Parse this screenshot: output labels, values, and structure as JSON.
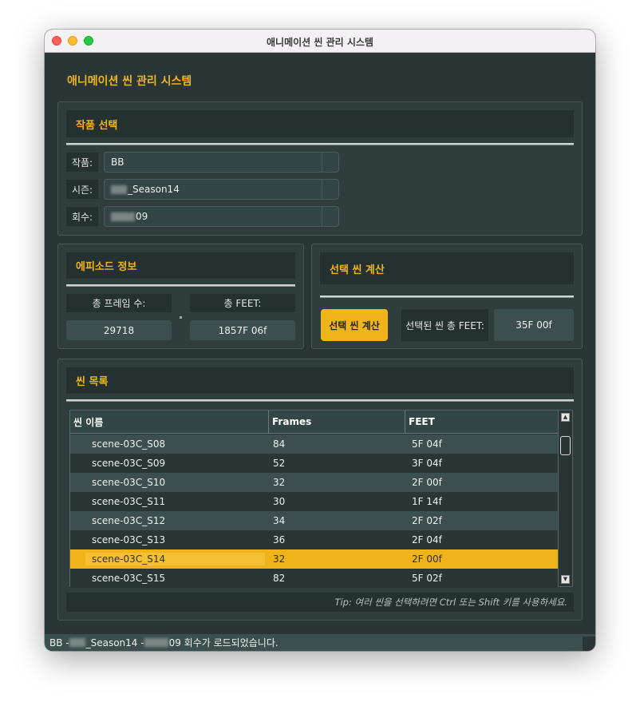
{
  "window": {
    "title": "애니메이션 씬 관리 시스템"
  },
  "app": {
    "title": "애니메이션 씬 관리 시스템"
  },
  "work_select": {
    "header": "작품 선택",
    "work_label": "작품:",
    "work_value": "BB",
    "season_label": "시즌:",
    "season_value": "_Season14",
    "episode_label": "회수:",
    "episode_value": "09"
  },
  "episode_info": {
    "header": "에피소드 정보",
    "total_frames_label": "총 프레임 수:",
    "total_frames_value": "29718",
    "total_feet_label": "총 FEET:",
    "total_feet_value": "1857F 06f"
  },
  "selection_calc": {
    "header": "선택 씬 계산",
    "button_label": "선택 씬 계산",
    "selected_feet_label": "선택된 씬 총 FEET:",
    "selected_feet_value": "35F 00f"
  },
  "scene_list": {
    "header": "씬 목록",
    "columns": [
      "씬 이름",
      "Frames",
      "FEET"
    ],
    "rows": [
      {
        "name": "scene-03C_S08",
        "frames": "84",
        "feet": "5F 04f"
      },
      {
        "name": "scene-03C_S09",
        "frames": "52",
        "feet": "3F 04f"
      },
      {
        "name": "scene-03C_S10",
        "frames": "32",
        "feet": "2F 00f"
      },
      {
        "name": "scene-03C_S11",
        "frames": "30",
        "feet": "1F 14f"
      },
      {
        "name": "scene-03C_S12",
        "frames": "34",
        "feet": "2F 02f"
      },
      {
        "name": "scene-03C_S13",
        "frames": "36",
        "feet": "2F 04f"
      },
      {
        "name": "scene-03C_S14",
        "frames": "32",
        "feet": "2F 00f"
      },
      {
        "name": "scene-03C_S15",
        "frames": "82",
        "feet": "5F 02f"
      }
    ],
    "tip": "Tip: 여러 씬을 선택하려면 Ctrl 또는 Shift 키를 사용하세요."
  },
  "status": {
    "part1": "BB - ",
    "part2": "_Season14 - ",
    "part3": "09 회수가 로드되었습니다."
  }
}
